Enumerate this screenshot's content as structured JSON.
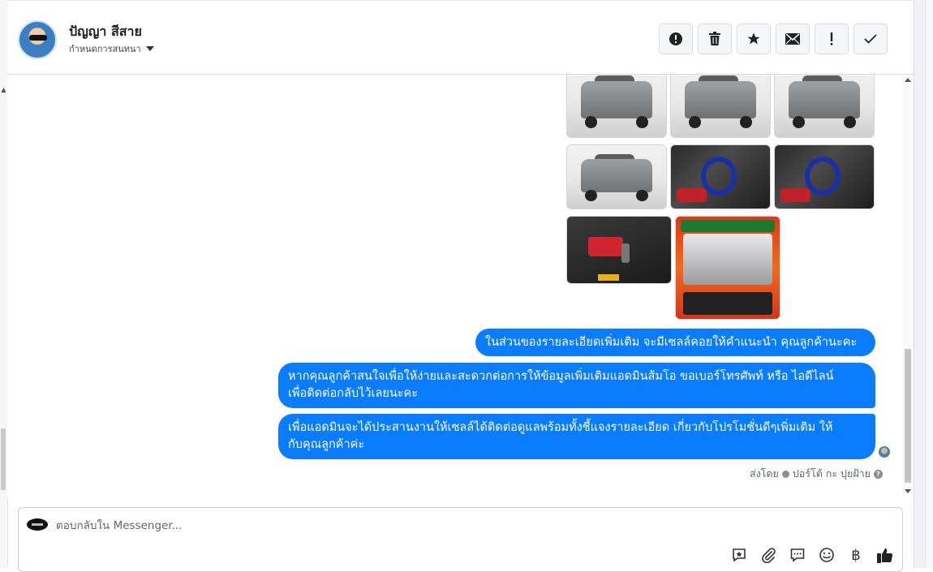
{
  "header": {
    "contact_name": "ปัญญา สีสาย",
    "assign_label": "กำหนดการสนทนา",
    "actions": [
      {
        "name": "mark-spam-button",
        "icon": "alert-circle-icon"
      },
      {
        "name": "delete-button",
        "icon": "trash-icon"
      },
      {
        "name": "star-button",
        "icon": "star-icon"
      },
      {
        "name": "mark-unread-button",
        "icon": "envelope-icon"
      },
      {
        "name": "follow-up-button",
        "icon": "exclamation-icon"
      },
      {
        "name": "mark-done-button",
        "icon": "check-icon"
      }
    ]
  },
  "messages": [
    {
      "lines": [
        "ในส่วนของรายละเอียดเพิ่มเติม จะมีเซลล์คอยให้คำแนะนำ คุณลูกค้านะคะ"
      ]
    },
    {
      "lines": [
        "หากคุณลูกค้าสนใจเพื่อให้ง่ายและสะดวกต่อการให้ข้อมูลเพิ่มเติมแอดมินส้มโอ ขอเบอร์โทรศัพท์ หรือ ไอดีไลน์",
        "เพื่อติดต่อกลับไว้เลยนะคะ"
      ]
    },
    {
      "lines": [
        "เพื่อแอดมินจะได้ประสานงานให้เซลล์ได้ติดต่อดูแลพร้อมทั้งชี้แจงรายละเอียด เกี่ยวกับโปรโมชั่นดีๆเพิ่มเติม ให้",
        "กับคุณลูกค้าค่ะ"
      ]
    }
  ],
  "sent_by": {
    "prefix": "ส่งโดย",
    "name": "ปอร์โต้ กะ ปุยฝ้าย",
    "help": "?"
  },
  "composer": {
    "placeholder": "ตอบกลับใน Messenger...",
    "tools": [
      "saved-reply-icon",
      "paperclip-icon",
      "chat-bubble-icon",
      "emoji-icon",
      "baht-icon",
      "thumbs-up-icon"
    ],
    "baht_symbol": "฿"
  },
  "colors": {
    "bubble": "#0a7cff",
    "header_border": "#dadde1"
  }
}
